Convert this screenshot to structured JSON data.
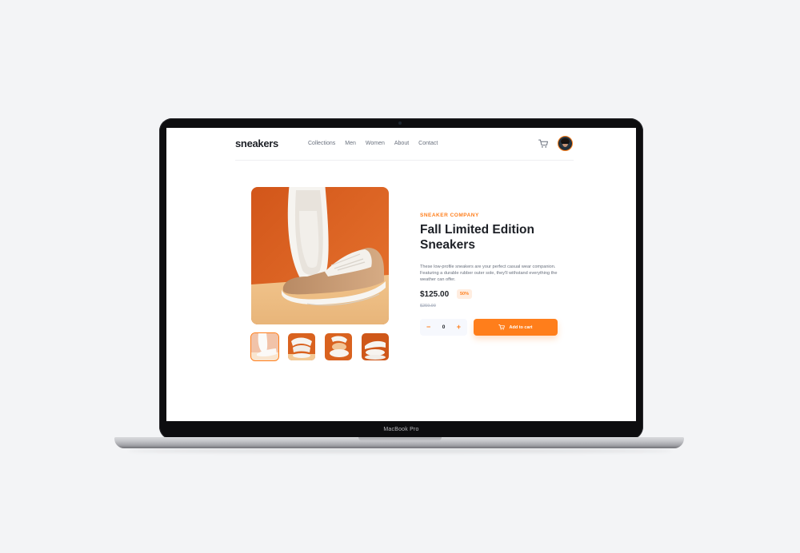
{
  "device": {
    "model_label": "MacBook Pro"
  },
  "header": {
    "logo": "sneakers",
    "nav": [
      "Collections",
      "Men",
      "Women",
      "About",
      "Contact"
    ]
  },
  "product": {
    "company": "SNEAKER COMPANY",
    "title": "Fall Limited Edition Sneakers",
    "description": "These low-profile sneakers are your perfect casual wear companion. Featuring a durable rubber outer sole, they'll withstand everything the weather can offer.",
    "price": "$125.00",
    "discount": "50%",
    "original_price": "$250.00",
    "quantity": "0",
    "decrement_label": "−",
    "increment_label": "+",
    "add_to_cart": "Add to cart"
  },
  "colors": {
    "accent": "#ff7e1b",
    "accent_pale": "#ffede0",
    "dark": "#1d2026",
    "gray": "#69707d"
  },
  "icons": [
    "cart-icon",
    "avatar",
    "minus-icon",
    "plus-icon"
  ]
}
